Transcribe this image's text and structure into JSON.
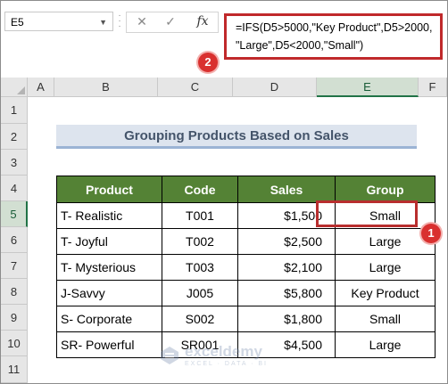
{
  "formula_bar": {
    "name_box": "E5",
    "cancel_icon": "x-icon",
    "confirm_icon": "check-icon",
    "fx_label": "fx",
    "formula_line1": "=IFS(D5>5000,\"Key Product\",D5>2000,",
    "formula_line2": "\"Large\",D5<2000,\"Small\")",
    "badge": "2"
  },
  "columns": [
    "A",
    "B",
    "C",
    "D",
    "E",
    "F"
  ],
  "rows": [
    "1",
    "2",
    "3",
    "4",
    "5",
    "6",
    "7",
    "8",
    "9",
    "10",
    "11"
  ],
  "sheet": {
    "title": "Grouping Products Based on Sales",
    "headers": [
      "Product",
      "Code",
      "Sales",
      "Group"
    ],
    "table": [
      [
        "T- Realistic",
        "T001",
        "$1,500",
        "Small"
      ],
      [
        "T- Joyful",
        "T002",
        "$2,500",
        "Large"
      ],
      [
        "T- Mysterious",
        "T003",
        "$2,100",
        "Large"
      ],
      [
        "J-Savvy",
        "J005",
        "$5,800",
        "Key Product"
      ],
      [
        "S- Corporate",
        "S002",
        "$1,800",
        "Small"
      ],
      [
        "SR- Powerful",
        "SR001",
        "$4,500",
        "Large"
      ]
    ],
    "selected_cell_badge": "1"
  },
  "watermark": {
    "name": "exceldemy",
    "tagline": "EXCEL · DATA · BI"
  },
  "colors": {
    "header_green": "#548235",
    "accent_red": "#c0292b",
    "title_band": "#dde4ee"
  }
}
